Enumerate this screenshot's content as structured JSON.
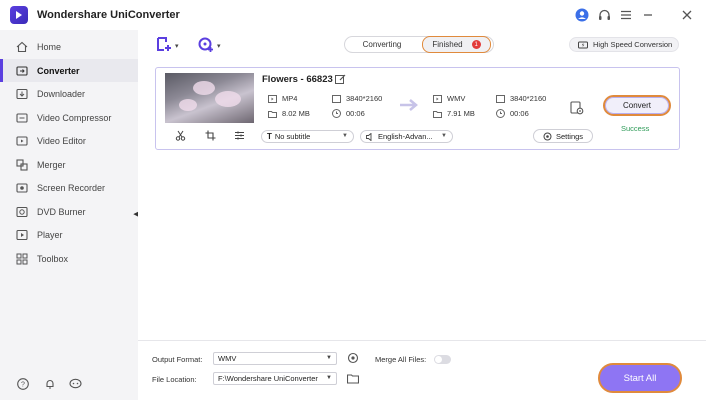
{
  "app": {
    "title": "Wondershare UniConverter",
    "logo_icon": "uniconverter-logo",
    "accent_color": "#5b3fe0",
    "highlight_color": "#e08a3c"
  },
  "titlebar_icons": [
    "user-icon",
    "headset-icon",
    "menu-icon",
    "minimize-icon",
    "close-icon"
  ],
  "sidebar": {
    "items": [
      {
        "label": "Home",
        "icon": "home-icon"
      },
      {
        "label": "Converter",
        "icon": "converter-icon",
        "active": true
      },
      {
        "label": "Downloader",
        "icon": "download-icon"
      },
      {
        "label": "Video Compressor",
        "icon": "compress-icon"
      },
      {
        "label": "Video Editor",
        "icon": "video-edit-icon"
      },
      {
        "label": "Merger",
        "icon": "merge-icon"
      },
      {
        "label": "Screen Recorder",
        "icon": "record-icon"
      },
      {
        "label": "DVD Burner",
        "icon": "dvd-icon"
      },
      {
        "label": "Player",
        "icon": "play-icon"
      },
      {
        "label": "Toolbox",
        "icon": "toolbox-icon"
      }
    ],
    "footer_icons": [
      "help-icon",
      "notification-icon",
      "feedback-icon"
    ]
  },
  "toolbar": {
    "add_files_icon": "add-file-icon",
    "add_disc_icon": "add-disc-icon",
    "tabs": {
      "converting": "Converting",
      "finished": "Finished",
      "finished_count": "1"
    },
    "high_speed_label": "High Speed Conversion"
  },
  "file": {
    "title": "Flowers - 66823",
    "source": {
      "format": "MP4",
      "resolution": "3840*2160",
      "size": "8.02 MB",
      "duration": "00:06"
    },
    "target": {
      "format": "WMV",
      "resolution": "3840*2160",
      "size": "7.91 MB",
      "duration": "00:06"
    },
    "subtitle": "No subtitle",
    "audio": "English-Advan...",
    "settings_label": "Settings",
    "convert_label": "Convert",
    "status": "Success",
    "status_color": "#2e9b58"
  },
  "footer": {
    "output_format_label": "Output Format:",
    "output_format_value": "WMV",
    "merge_label": "Merge All Files:",
    "file_location_label": "File Location:",
    "file_location_value": "F:\\Wondershare UniConverter",
    "start_all_label": "Start All"
  }
}
